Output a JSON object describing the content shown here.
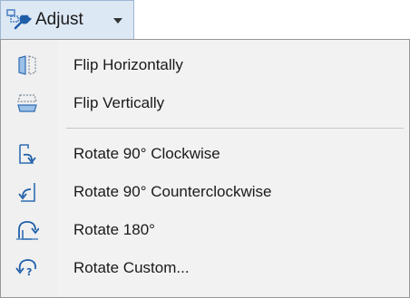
{
  "toolbar": {
    "adjust_label": "Adjust"
  },
  "menu": {
    "items": [
      {
        "label": "Flip Horizontally",
        "icon": "flip-horizontal-icon"
      },
      {
        "label": "Flip Vertically",
        "icon": "flip-vertical-icon"
      },
      {
        "label": "Rotate 90° Clockwise",
        "icon": "rotate-clockwise-icon"
      },
      {
        "label": "Rotate 90° Counterclockwise",
        "icon": "rotate-counterclockwise-icon"
      },
      {
        "label": "Rotate 180°",
        "icon": "rotate-180-icon"
      },
      {
        "label": "Rotate Custom...",
        "icon": "rotate-custom-icon"
      }
    ]
  },
  "colors": {
    "accent": "#1f6fc5",
    "button_bg": "#dde8f5",
    "menu_bg": "#f2f2f2",
    "border": "#979797"
  }
}
